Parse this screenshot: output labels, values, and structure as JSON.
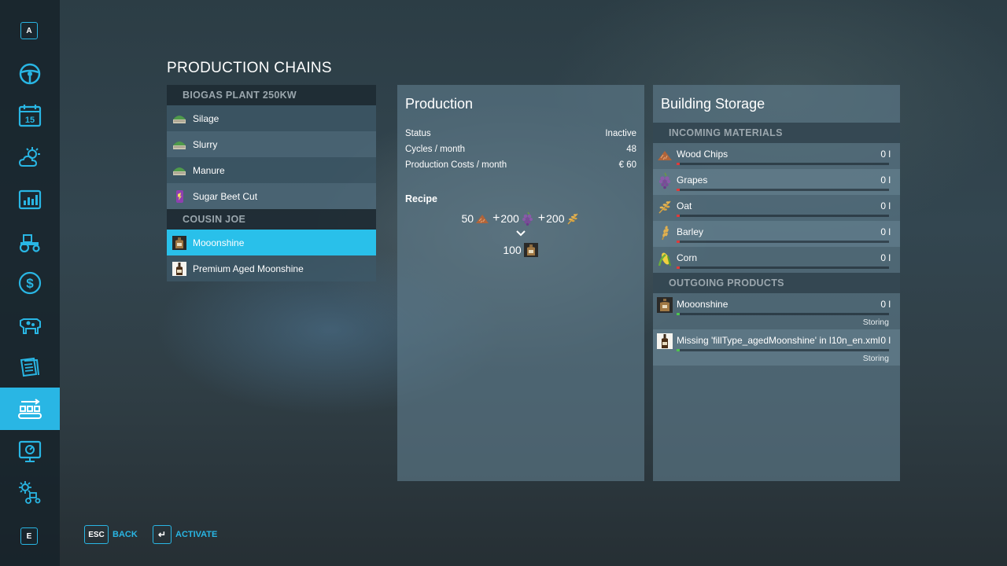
{
  "sidebar": {
    "top_key": "A",
    "bottom_key": "E",
    "active_index": 9,
    "accent": "#29b6e4"
  },
  "page_title": "PRODUCTION CHAINS",
  "chains": {
    "groups": [
      {
        "name": "BIOGAS PLANT 250KW",
        "items": [
          {
            "label": "Silage",
            "icon": "silage-icon"
          },
          {
            "label": "Slurry",
            "icon": "slurry-icon"
          },
          {
            "label": "Manure",
            "icon": "manure-icon"
          },
          {
            "label": "Sugar Beet Cut",
            "icon": "sugar-beet-cut-icon"
          }
        ]
      },
      {
        "name": "COUSIN JOE",
        "items": [
          {
            "label": "Mooonshine",
            "icon": "moonshine-jug-icon"
          },
          {
            "label": "Premium Aged Moonshine",
            "icon": "aged-moonshine-bottle-icon"
          }
        ]
      }
    ],
    "selected": "Mooonshine"
  },
  "production": {
    "title": "Production",
    "stats": [
      {
        "label": "Status",
        "value": "Inactive"
      },
      {
        "label": "Cycles / month",
        "value": "48"
      },
      {
        "label": "Production Costs / month",
        "value": "€ 60"
      }
    ],
    "recipe_label": "Recipe",
    "recipe_inputs": [
      {
        "amount": "50",
        "icon": "wood-chips-icon"
      },
      {
        "amount": "200",
        "icon": "grapes-icon"
      },
      {
        "amount": "200",
        "icon": "oat-icon"
      }
    ],
    "recipe_output": {
      "amount": "100",
      "icon": "moonshine-jug-icon"
    }
  },
  "storage": {
    "title": "Building Storage",
    "incoming_label": "INCOMING MATERIALS",
    "incoming": [
      {
        "name": "Wood Chips",
        "amount": "0 l",
        "icon": "wood-chips-icon",
        "fill": 0
      },
      {
        "name": "Grapes",
        "amount": "0 l",
        "icon": "grapes-icon",
        "fill": 0
      },
      {
        "name": "Oat",
        "amount": "0 l",
        "icon": "oat-icon",
        "fill": 0
      },
      {
        "name": "Barley",
        "amount": "0 l",
        "icon": "barley-icon",
        "fill": 0
      },
      {
        "name": "Corn",
        "amount": "0 l",
        "icon": "corn-icon",
        "fill": 0
      }
    ],
    "outgoing_label": "OUTGOING PRODUCTS",
    "outgoing": [
      {
        "name": "Mooonshine",
        "amount": "0 l",
        "status": "Storing",
        "icon": "moonshine-jug-icon",
        "fill": 0
      },
      {
        "name": "Missing 'fillType_agedMoonshine' in l10n_en.xml",
        "amount": "0 l",
        "status": "Storing",
        "icon": "aged-moonshine-bottle-icon",
        "fill": 0
      }
    ],
    "empty_color_incoming": "#e03a3a",
    "empty_color_outgoing": "#4ec34e"
  },
  "footer": {
    "back_key": "ESC",
    "back_label": "BACK",
    "activate_key": "↵",
    "activate_label": "ACTIVATE"
  }
}
